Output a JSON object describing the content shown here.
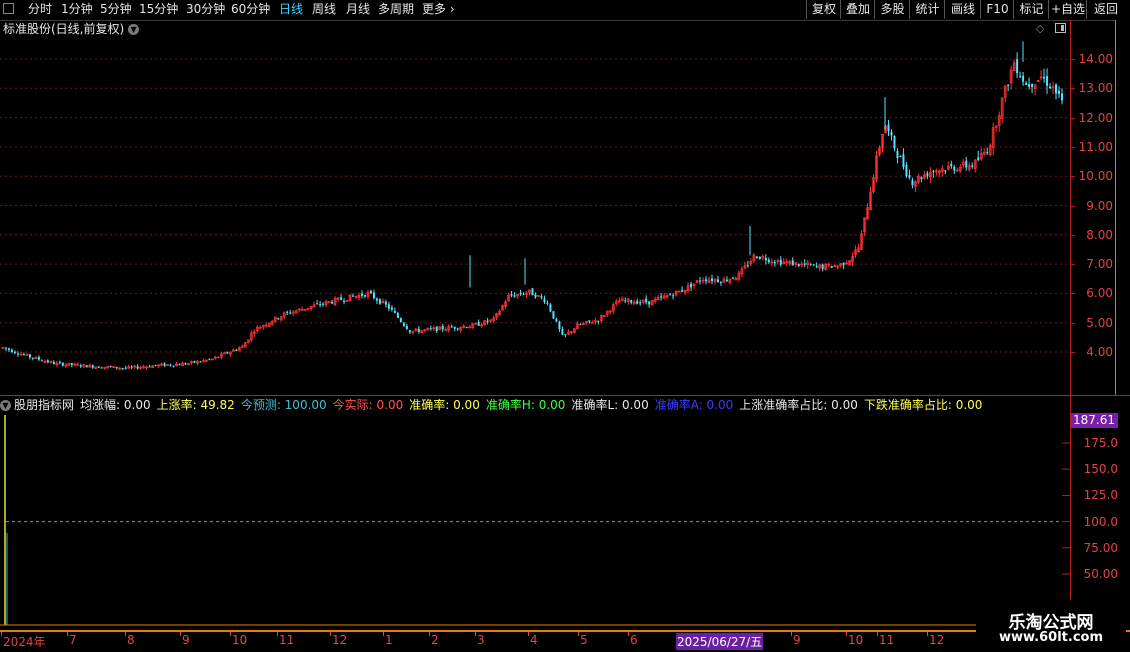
{
  "toolbar": {
    "periods": [
      "分时",
      "1分钟",
      "5分钟",
      "15分钟",
      "30分钟",
      "60分钟",
      "日线",
      "周线",
      "月线",
      "多周期",
      "更多"
    ],
    "active_period": "日线",
    "right_buttons": [
      "复权",
      "叠加",
      "多股",
      "统计",
      "画线",
      "F10",
      "标记",
      "+自选",
      "返回"
    ]
  },
  "stock": {
    "title": "标准股份(日线,前复权)"
  },
  "main_axis": {
    "ticks": [
      "14.00",
      "13.00",
      "12.00",
      "11.00",
      "10.00",
      "9.00",
      "8.00",
      "7.00",
      "6.00",
      "5.00",
      "4.00"
    ]
  },
  "indicator": {
    "name": "股朋指标网",
    "fields": [
      {
        "label": "均涨幅:",
        "value": "0.00",
        "color": "#e8e8e8"
      },
      {
        "label": "上涨率:",
        "value": "49.82",
        "color": "#ffff55"
      },
      {
        "label": "今预测:",
        "value": "100.00",
        "color": "#3fc0d0"
      },
      {
        "label": "今实际:",
        "value": "0.00",
        "color": "#ff5555"
      },
      {
        "label": "准确率:",
        "value": "0.00",
        "color": "#ffff55"
      },
      {
        "label": "准确率H:",
        "value": "0.00",
        "color": "#44ff44"
      },
      {
        "label": "准确率L:",
        "value": "0.00",
        "color": "#e8e8e8"
      },
      {
        "label": "准确率A:",
        "value": "0.00",
        "color": "#3a3aff"
      },
      {
        "label": "上涨准确率占比:",
        "value": "0.00",
        "color": "#e8e8e8"
      },
      {
        "label": "下跌准确率占比:",
        "value": "0.00",
        "color": "#ffff55"
      }
    ],
    "current_value": "187.61",
    "ticks": [
      "175.0",
      "150.0",
      "125.0",
      "100.0",
      "75.00",
      "50.00"
    ],
    "reference_value": 100
  },
  "dates": {
    "labels": [
      "2024年",
      "7",
      "8",
      "9",
      "10",
      "11",
      "12",
      "1",
      "2",
      "3",
      "4",
      "5",
      "6",
      "9",
      "10",
      "11",
      "12"
    ],
    "current": "2025/06/27/五"
  },
  "watermark": {
    "line1": "乐淘公式网",
    "line2": "www.60lt.com"
  },
  "colors": {
    "up": "#ff3232",
    "down": "#52e5ff",
    "grid": "#6a1a1a",
    "axis": "#b81d1d",
    "active": "#3fd0ff"
  },
  "chart_data": {
    "type": "candlestick",
    "ylim": [
      3.5,
      14.8
    ],
    "x": [
      "2024-06",
      "2024-07",
      "2024-08",
      "2024-09",
      "2024-10",
      "2024-11",
      "2024-12",
      "2025-01",
      "2025-02",
      "2025-03",
      "2025-04",
      "2025-05",
      "2025-06",
      "2025-07",
      "2025-08",
      "2025-09",
      "2025-10",
      "2025-11",
      "2025-12"
    ],
    "close": [
      4.15,
      3.55,
      3.45,
      3.75,
      4.85,
      5.6,
      5.9,
      4.6,
      4.9,
      5.2,
      5.1,
      5.65,
      6.1,
      6.6,
      7.2,
      6.9,
      6.85,
      10.3,
      10.4,
      14.0,
      12.5
    ],
    "max_high": 14.6,
    "min_low": 3.3
  }
}
